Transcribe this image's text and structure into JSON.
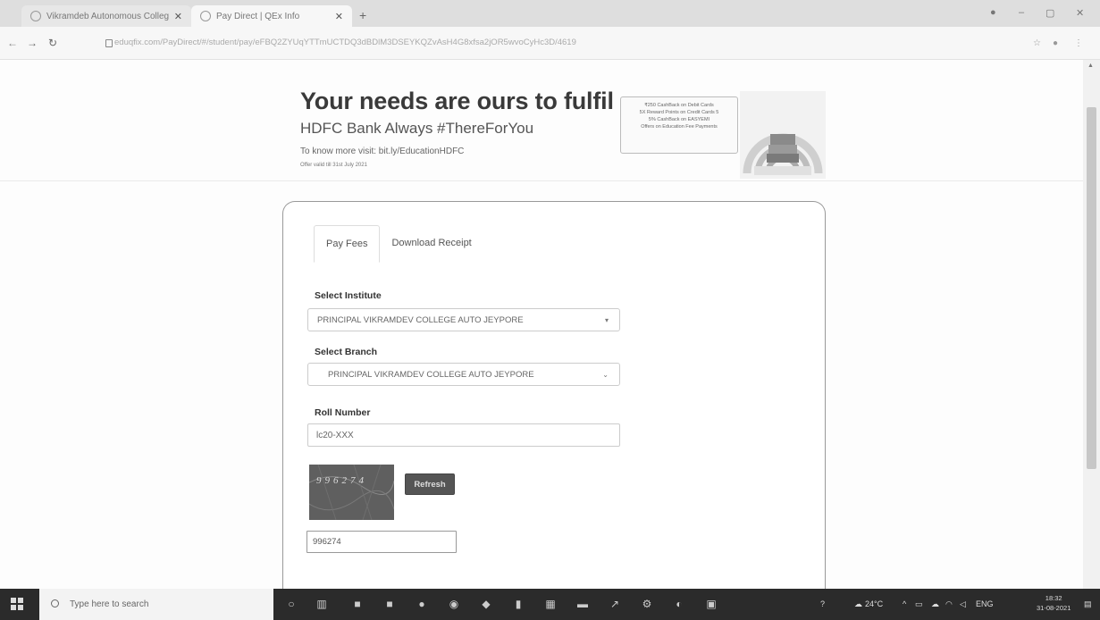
{
  "browser": {
    "tabs": [
      {
        "label": "Vikramdeb Autonomous Colleg"
      },
      {
        "label": "Pay Direct | QEx Info"
      }
    ],
    "new_tab": "+",
    "url": "eduqfix.com/PayDirect/#/student/pay/eFBQ2ZYUqYTTmUCTDQ3dBDlM3DSEYKQZvAsH4G8xfsa2jOR5wvoCyHc3D/4619",
    "controls": {
      "minimize": "–",
      "maximize": "▢",
      "close": "✕"
    }
  },
  "banner": {
    "title": "Your needs are ours to fulfil",
    "subtitle": "HDFC Bank Always #ThereForYou",
    "link_text": "To know more visit: bit.ly/EducationHDFC",
    "fine_print": "Offer valid till 31st July 2021",
    "offers": [
      "₹250 CashBack on Debit Cards",
      "5X Reward Points on Credit Cards 5",
      "5% CashBack on EASYEMI",
      "Offers on Education Fee Payments"
    ]
  },
  "form": {
    "tabs": [
      {
        "label": "Pay Fees",
        "active": true
      },
      {
        "label": "Download Receipt",
        "active": false
      }
    ],
    "institute_label": "Select Institute",
    "institute_value": "PRINCIPAL VIKRAMDEV COLLEGE AUTO JEYPORE",
    "branch_label": "Select Branch",
    "branch_value": "PRINCIPAL VIKRAMDEV COLLEGE AUTO JEYPORE",
    "roll_label": "Roll Number",
    "roll_value": "lc20-XXX",
    "captcha_text": "996274",
    "refresh_label": "Refresh",
    "captcha_input_value": "996274"
  },
  "taskbar": {
    "search_placeholder": "Type here to search",
    "weather": "24°C",
    "language": "ENG",
    "time": "18:32",
    "date": "31-08-2021"
  }
}
